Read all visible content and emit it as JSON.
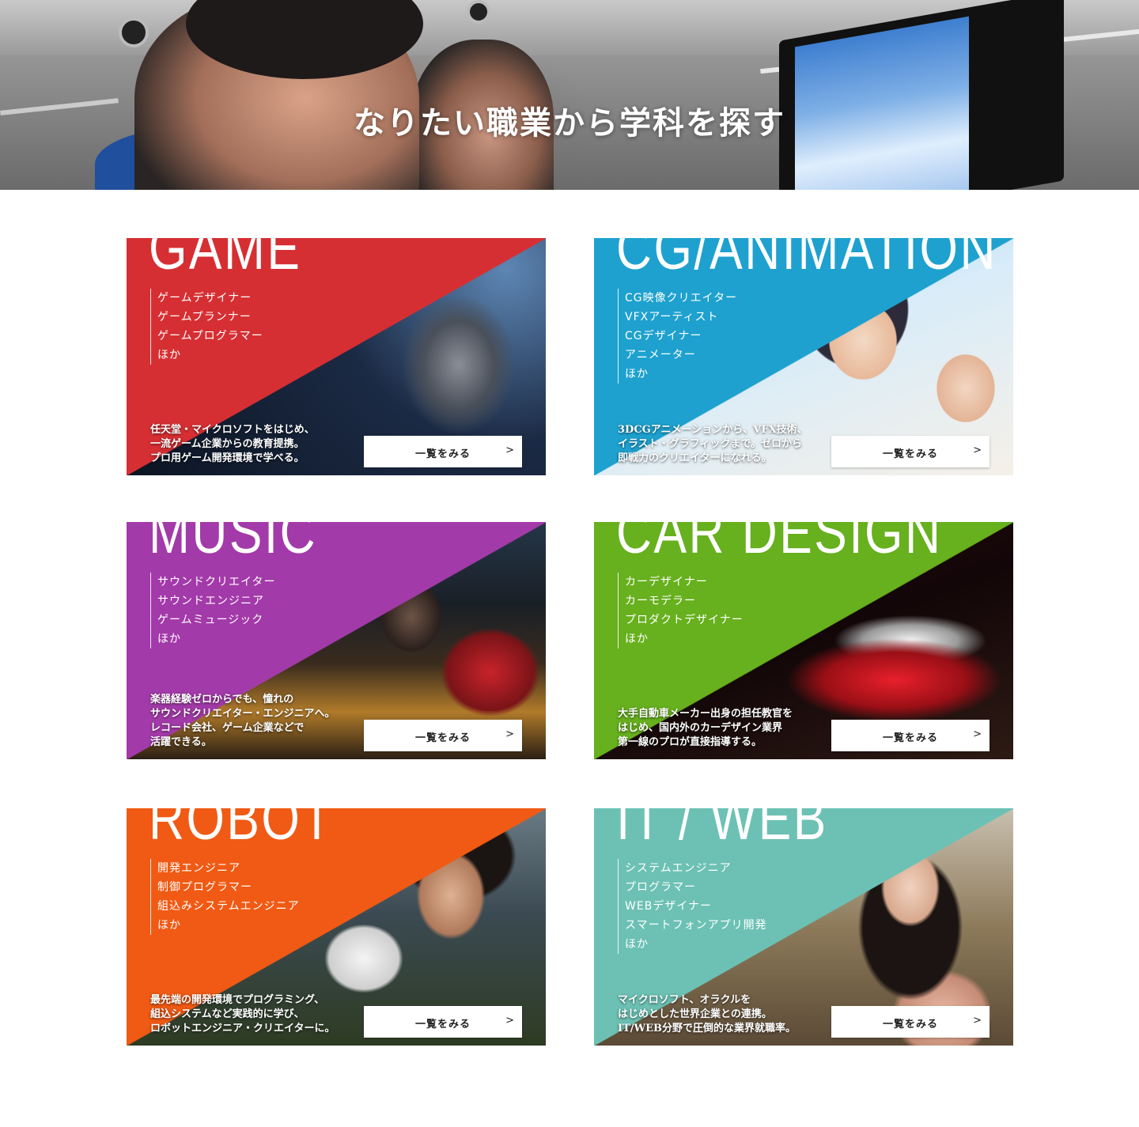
{
  "hero": {
    "title": "なりたい職業から学科を探す"
  },
  "cards": [
    {
      "category": "GAME",
      "color": "#d62f33",
      "jobs": [
        "ゲームデザイナー",
        "ゲームプランナー",
        "ゲームプログラマー",
        "ほか"
      ],
      "description": [
        "任天堂・マイクロソフトをはじめ、",
        "一流ゲーム企業からの教育提携。",
        "プロ用ゲーム開発環境で学べる。"
      ],
      "button": "一覧をみる",
      "arrow": ">"
    },
    {
      "category": "CG/ANIMATION",
      "color": "#1ea1cf",
      "jobs": [
        "CG映像クリエイター",
        "VFXアーティスト",
        "CGデザイナー",
        "アニメーター",
        "ほか"
      ],
      "description": [
        "3DCGアニメーションから、VFX技術、",
        "イラスト・グラフィックまで。ゼロから",
        "即戦力のクリエイターになれる。"
      ],
      "button": "一覧をみる",
      "arrow": ">"
    },
    {
      "category": "MUSIC",
      "color": "#a33aa9",
      "jobs": [
        "サウンドクリエイター",
        "サウンドエンジニア",
        "ゲームミュージック",
        "ほか"
      ],
      "description": [
        "楽器経験ゼロからでも、憧れの",
        "サウンドクリエイター・エンジニアへ。",
        "レコード会社、ゲーム企業などで",
        "活躍できる。"
      ],
      "button": "一覧をみる",
      "arrow": ">"
    },
    {
      "category": "CAR DESIGN",
      "color": "#67b01e",
      "jobs": [
        "カーデザイナー",
        "カーモデラー",
        "プロダクトデザイナー",
        "ほか"
      ],
      "description": [
        "大手自動車メーカー出身の担任教官を",
        "はじめ、国内外のカーデザイン業界",
        "第一線のプロが直接指導する。"
      ],
      "button": "一覧をみる",
      "arrow": ">"
    },
    {
      "category": "ROBOT",
      "color": "#f05a14",
      "jobs": [
        "開発エンジニア",
        "制御プログラマー",
        "組込みシステムエンジニア",
        "ほか"
      ],
      "description": [
        "最先端の開発環境でプログラミング、",
        "組込システムなど実践的に学び、",
        "ロボットエンジニア・クリエイターに。"
      ],
      "button": "一覧をみる",
      "arrow": ">"
    },
    {
      "category": "IT / WEB",
      "color": "#6cc1b4",
      "jobs": [
        "システムエンジニア",
        "プログラマー",
        "WEBデザイナー",
        "スマートフォンアプリ開発",
        "ほか"
      ],
      "description": [
        "マイクロソフト、オラクルを",
        "はじめとした世界企業との連携。",
        "IT/WEB分野で圧倒的な業界就職率。"
      ],
      "button": "一覧をみる",
      "arrow": ">"
    }
  ]
}
